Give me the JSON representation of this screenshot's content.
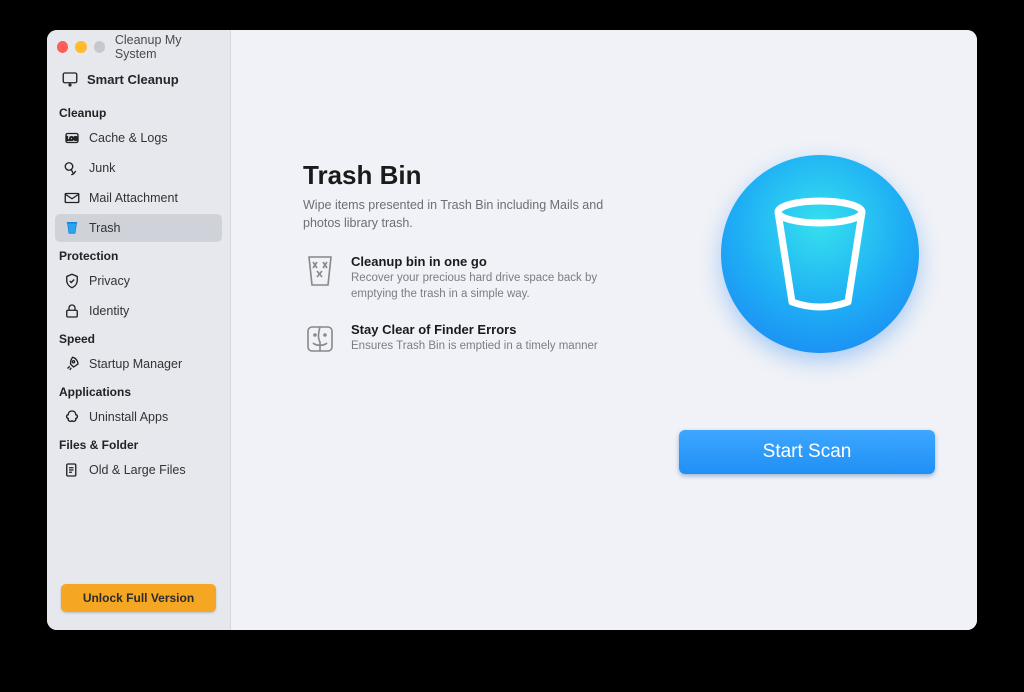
{
  "window": {
    "title": "Cleanup My System"
  },
  "top_item": {
    "label": "Smart Cleanup"
  },
  "sections": {
    "cleanup": {
      "header": "Cleanup",
      "items": [
        {
          "label": "Cache & Logs"
        },
        {
          "label": "Junk"
        },
        {
          "label": "Mail Attachment"
        },
        {
          "label": "Trash",
          "selected": true
        }
      ]
    },
    "protection": {
      "header": "Protection",
      "items": [
        {
          "label": "Privacy"
        },
        {
          "label": "Identity"
        }
      ]
    },
    "speed": {
      "header": "Speed",
      "items": [
        {
          "label": "Startup Manager"
        }
      ]
    },
    "applications": {
      "header": "Applications",
      "items": [
        {
          "label": "Uninstall Apps"
        }
      ]
    },
    "files": {
      "header": "Files & Folder",
      "items": [
        {
          "label": "Old & Large Files"
        }
      ]
    }
  },
  "unlock_label": "Unlock Full Version",
  "page": {
    "title": "Trash Bin",
    "subtitle": "Wipe items presented in Trash Bin including Mails and photos library trash.",
    "features": [
      {
        "title": "Cleanup bin in one go",
        "desc": "Recover your precious hard drive space back by emptying the trash in a simple way."
      },
      {
        "title": "Stay Clear of Finder Errors",
        "desc": "Ensures Trash Bin is emptied in a timely manner"
      }
    ],
    "start_label": "Start Scan"
  }
}
